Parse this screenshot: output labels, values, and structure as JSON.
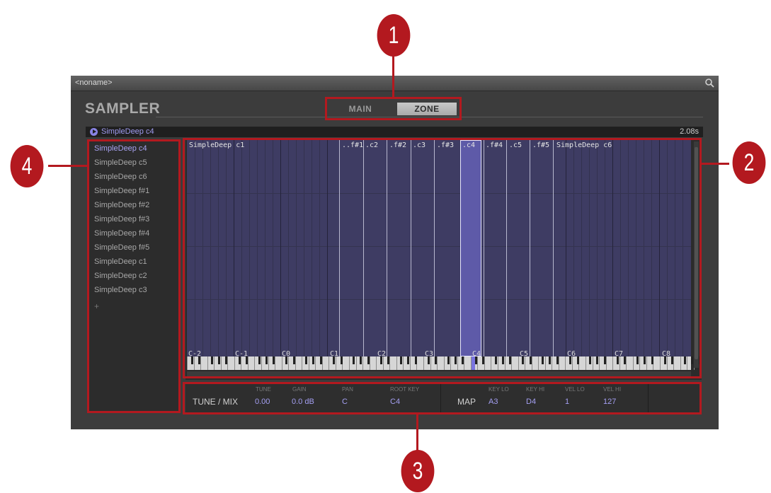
{
  "window": {
    "title": "<noname>",
    "search_icon": "search-icon"
  },
  "header": {
    "title": "SAMPLER",
    "tabs": [
      {
        "label": "MAIN",
        "selected": false
      },
      {
        "label": "ZONE",
        "selected": true
      }
    ]
  },
  "sample_bar": {
    "name": "SimpleDeep c4",
    "length": "2.08s",
    "play_icon": "play-icon"
  },
  "sample_list": {
    "items": [
      {
        "label": "SimpleDeep c4",
        "selected": true
      },
      {
        "label": "SimpleDeep c5",
        "selected": false
      },
      {
        "label": "SimpleDeep c6",
        "selected": false
      },
      {
        "label": "SimpleDeep f#1",
        "selected": false
      },
      {
        "label": "SimpleDeep f#2",
        "selected": false
      },
      {
        "label": "SimpleDeep f#3",
        "selected": false
      },
      {
        "label": "SimpleDeep f#4",
        "selected": false
      },
      {
        "label": "SimpleDeep f#5",
        "selected": false
      },
      {
        "label": "SimpleDeep c1",
        "selected": false
      },
      {
        "label": "SimpleDeep c2",
        "selected": false
      },
      {
        "label": "SimpleDeep c3",
        "selected": false
      }
    ],
    "add_label": "+"
  },
  "zone_map": {
    "zones": [
      "SimpleDeep c1",
      "..f#1",
      ".c2",
      ".f#2",
      ".c3",
      ".f#3",
      ".c4",
      ".f#4",
      ".c5",
      ".f#5",
      "SimpleDeep c6"
    ],
    "selected_zone": ".c4",
    "octaves": [
      "C-2",
      "C-1",
      "C0",
      "C1",
      "C2",
      "C3",
      "C4",
      "C5",
      "C6",
      "C7",
      "C8"
    ]
  },
  "params": {
    "tune_mix": {
      "section": "TUNE / MIX",
      "tune_label": "TUNE",
      "tune_value": "0.00",
      "gain_label": "GAIN",
      "gain_value": "0.0 dB",
      "pan_label": "PAN",
      "pan_value": "C",
      "rootkey_label": "ROOT KEY",
      "rootkey_value": "C4"
    },
    "map": {
      "section": "MAP",
      "keylo_label": "KEY LO",
      "keylo_value": "A3",
      "keyhi_label": "KEY HI",
      "keyhi_value": "D4",
      "vello_label": "VEL LO",
      "vello_value": "1",
      "velhi_label": "VEL HI",
      "velhi_value": "127"
    }
  },
  "callouts": [
    "1",
    "2",
    "3",
    "4"
  ],
  "colors": {
    "callout_red": "#b3191f",
    "accent_purple": "#a49ff2",
    "zone_fill": "#3e3c63"
  }
}
